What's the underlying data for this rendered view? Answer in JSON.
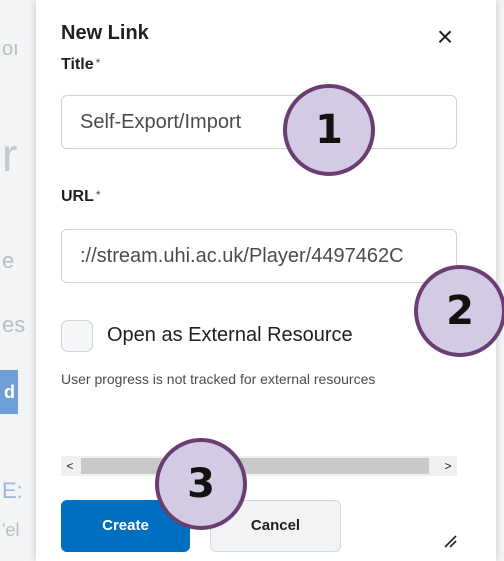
{
  "background": {
    "fragments": [
      "oı",
      "r",
      "e",
      "es",
      "d",
      "E:",
      "'el"
    ]
  },
  "dialog": {
    "title": "New Link",
    "close_label": "×",
    "title_field": {
      "label": "Title",
      "required_mark": "*",
      "value": "Self-Export/Import"
    },
    "url_field": {
      "label": "URL",
      "required_mark": "*",
      "value": "://stream.uhi.ac.uk/Player/4497462C"
    },
    "external": {
      "label": "Open as External Resource",
      "checked": false,
      "help": "User progress is not tracked for external resources"
    },
    "scrollbar": {
      "left_arrow": "<",
      "right_arrow": ">"
    },
    "buttons": {
      "create": "Create",
      "cancel": "Cancel"
    }
  },
  "callouts": [
    "1",
    "2",
    "3"
  ],
  "colors": {
    "primary": "#006fbf",
    "callout_fill": "#d2cbe3",
    "callout_border": "#6b3d72"
  }
}
